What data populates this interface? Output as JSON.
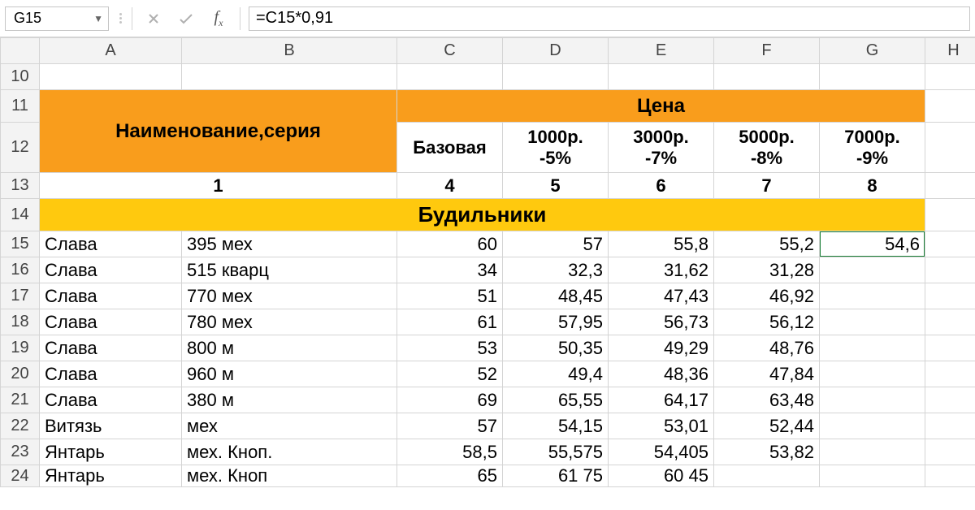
{
  "name_box": "G15",
  "formula": "=C15*0,91",
  "columns": [
    "A",
    "B",
    "C",
    "D",
    "E",
    "F",
    "G",
    "H"
  ],
  "row_labels": [
    "10",
    "11",
    "12",
    "13",
    "14",
    "15",
    "16",
    "17",
    "18",
    "19",
    "20",
    "21",
    "22",
    "23",
    "24"
  ],
  "header": {
    "name_series": "Наименование,серия",
    "price": "Цена",
    "sub": {
      "base": "Базовая",
      "d1": "1000р.",
      "d1b": "-5%",
      "d2": "3000р.",
      "d2b": "-7%",
      "d3": "5000р.",
      "d3b": "-8%",
      "d4": "7000р.",
      "d4b": "-9%"
    },
    "nums": {
      "a": "1",
      "c": "4",
      "d": "5",
      "e": "6",
      "f": "7",
      "g": "8"
    }
  },
  "section_title": "Будильники",
  "rows": [
    {
      "a": "Слава",
      "b": "395 мех",
      "c": "60",
      "d": "57",
      "e": "55,8",
      "f": "55,2",
      "g": "54,6"
    },
    {
      "a": "Слава",
      "b": "515 кварц",
      "c": "34",
      "d": "32,3",
      "e": "31,62",
      "f": "31,28",
      "g": ""
    },
    {
      "a": "Слава",
      "b": "770 мех",
      "c": "51",
      "d": "48,45",
      "e": "47,43",
      "f": "46,92",
      "g": ""
    },
    {
      "a": "Слава",
      "b": "780 мех",
      "c": "61",
      "d": "57,95",
      "e": "56,73",
      "f": "56,12",
      "g": ""
    },
    {
      "a": "Слава",
      "b": "800 м",
      "c": "53",
      "d": "50,35",
      "e": "49,29",
      "f": "48,76",
      "g": ""
    },
    {
      "a": "Слава",
      "b": "960 м",
      "c": "52",
      "d": "49,4",
      "e": "48,36",
      "f": "47,84",
      "g": ""
    },
    {
      "a": "Слава",
      "b": "380 м",
      "c": "69",
      "d": "65,55",
      "e": "64,17",
      "f": "63,48",
      "g": ""
    },
    {
      "a": "Витязь",
      "b": "мех",
      "c": "57",
      "d": "54,15",
      "e": "53,01",
      "f": "52,44",
      "g": ""
    },
    {
      "a": "Янтарь",
      "b": "мех. Кноп.",
      "c": "58,5",
      "d": "55,575",
      "e": "54,405",
      "f": "53,82",
      "g": ""
    },
    {
      "a": "Янтарь",
      "b": "мех. Кноп",
      "c": "65",
      "d": "61 75",
      "e": "60 45",
      "f": "",
      "g": ""
    }
  ]
}
